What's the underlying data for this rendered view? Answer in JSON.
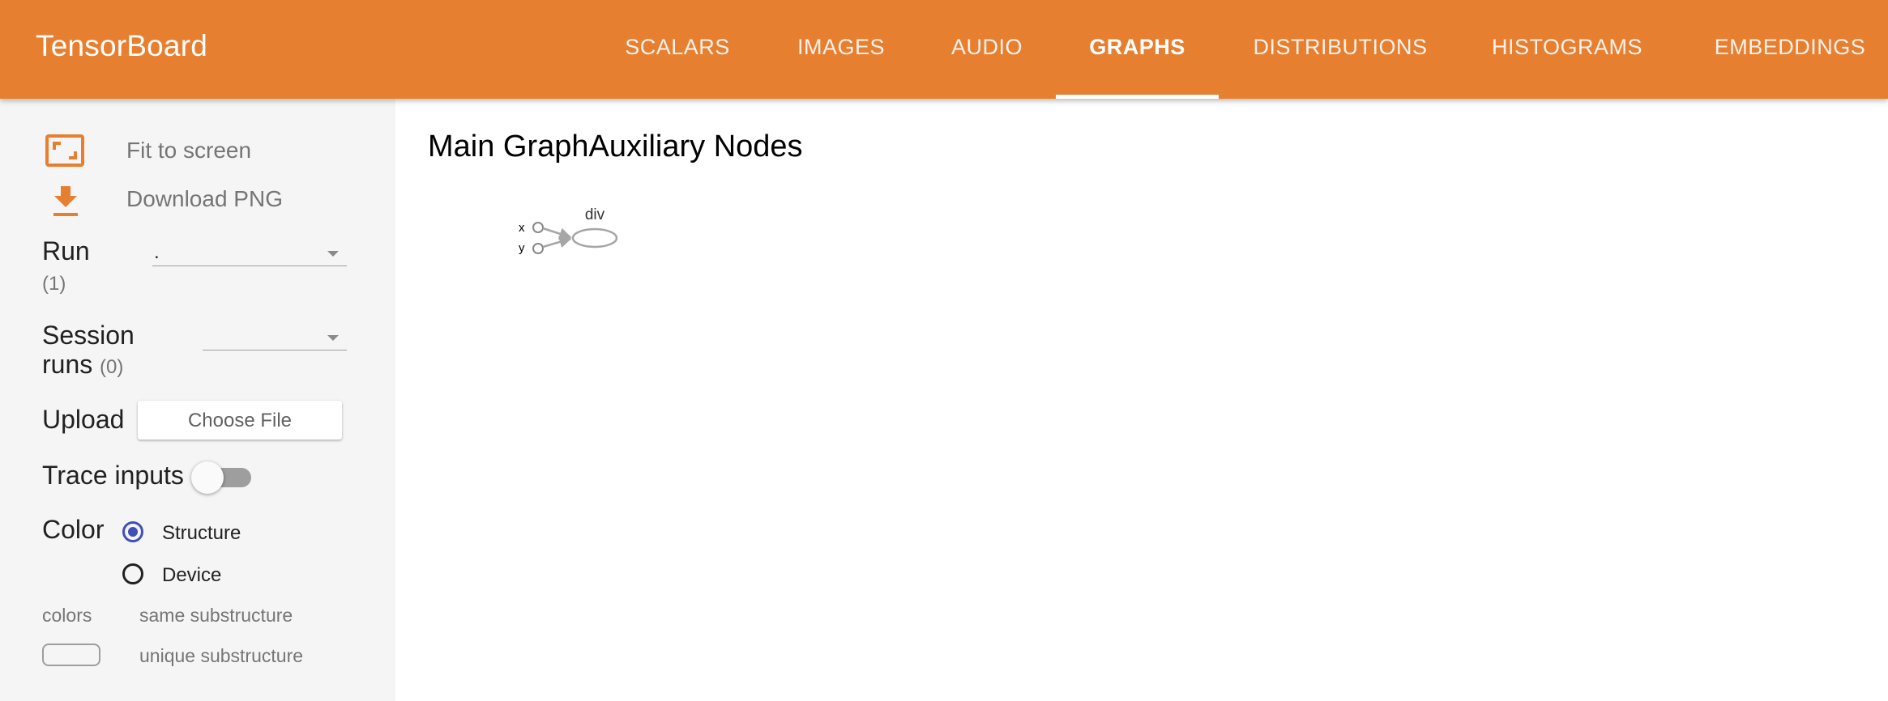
{
  "app": {
    "title": "TensorBoard"
  },
  "tabs": [
    {
      "label": "SCALARS",
      "active": false
    },
    {
      "label": "IMAGES",
      "active": false
    },
    {
      "label": "AUDIO",
      "active": false
    },
    {
      "label": "GRAPHS",
      "active": true
    },
    {
      "label": "DISTRIBUTIONS",
      "active": false
    },
    {
      "label": "HISTOGRAMS",
      "active": false
    },
    {
      "label": "EMBEDDINGS",
      "active": false
    }
  ],
  "sidebar": {
    "fit_label": "Fit to screen",
    "download_label": "Download PNG",
    "run": {
      "label": "Run",
      "count": "(1)",
      "value": "."
    },
    "session_runs": {
      "label_line1": "Session",
      "label_line2": "runs",
      "count": "(0)",
      "value": ""
    },
    "upload": {
      "label": "Upload",
      "button": "Choose File"
    },
    "trace_inputs": {
      "label": "Trace inputs",
      "enabled": false
    },
    "color": {
      "label": "Color",
      "options": [
        {
          "label": "Structure",
          "selected": true
        },
        {
          "label": "Device",
          "selected": false
        }
      ]
    },
    "legend": {
      "colors_label": "colors",
      "same_label": "same substructure",
      "unique_label": "unique substructure"
    }
  },
  "main": {
    "title": "Main GraphAuxiliary Nodes",
    "graph": {
      "op_node": "div",
      "inputs": [
        "x",
        "y"
      ]
    }
  },
  "colors": {
    "brand": "#e77f30",
    "radio_accent": "#3f51b5",
    "node_stroke": "#a6a6a6"
  }
}
